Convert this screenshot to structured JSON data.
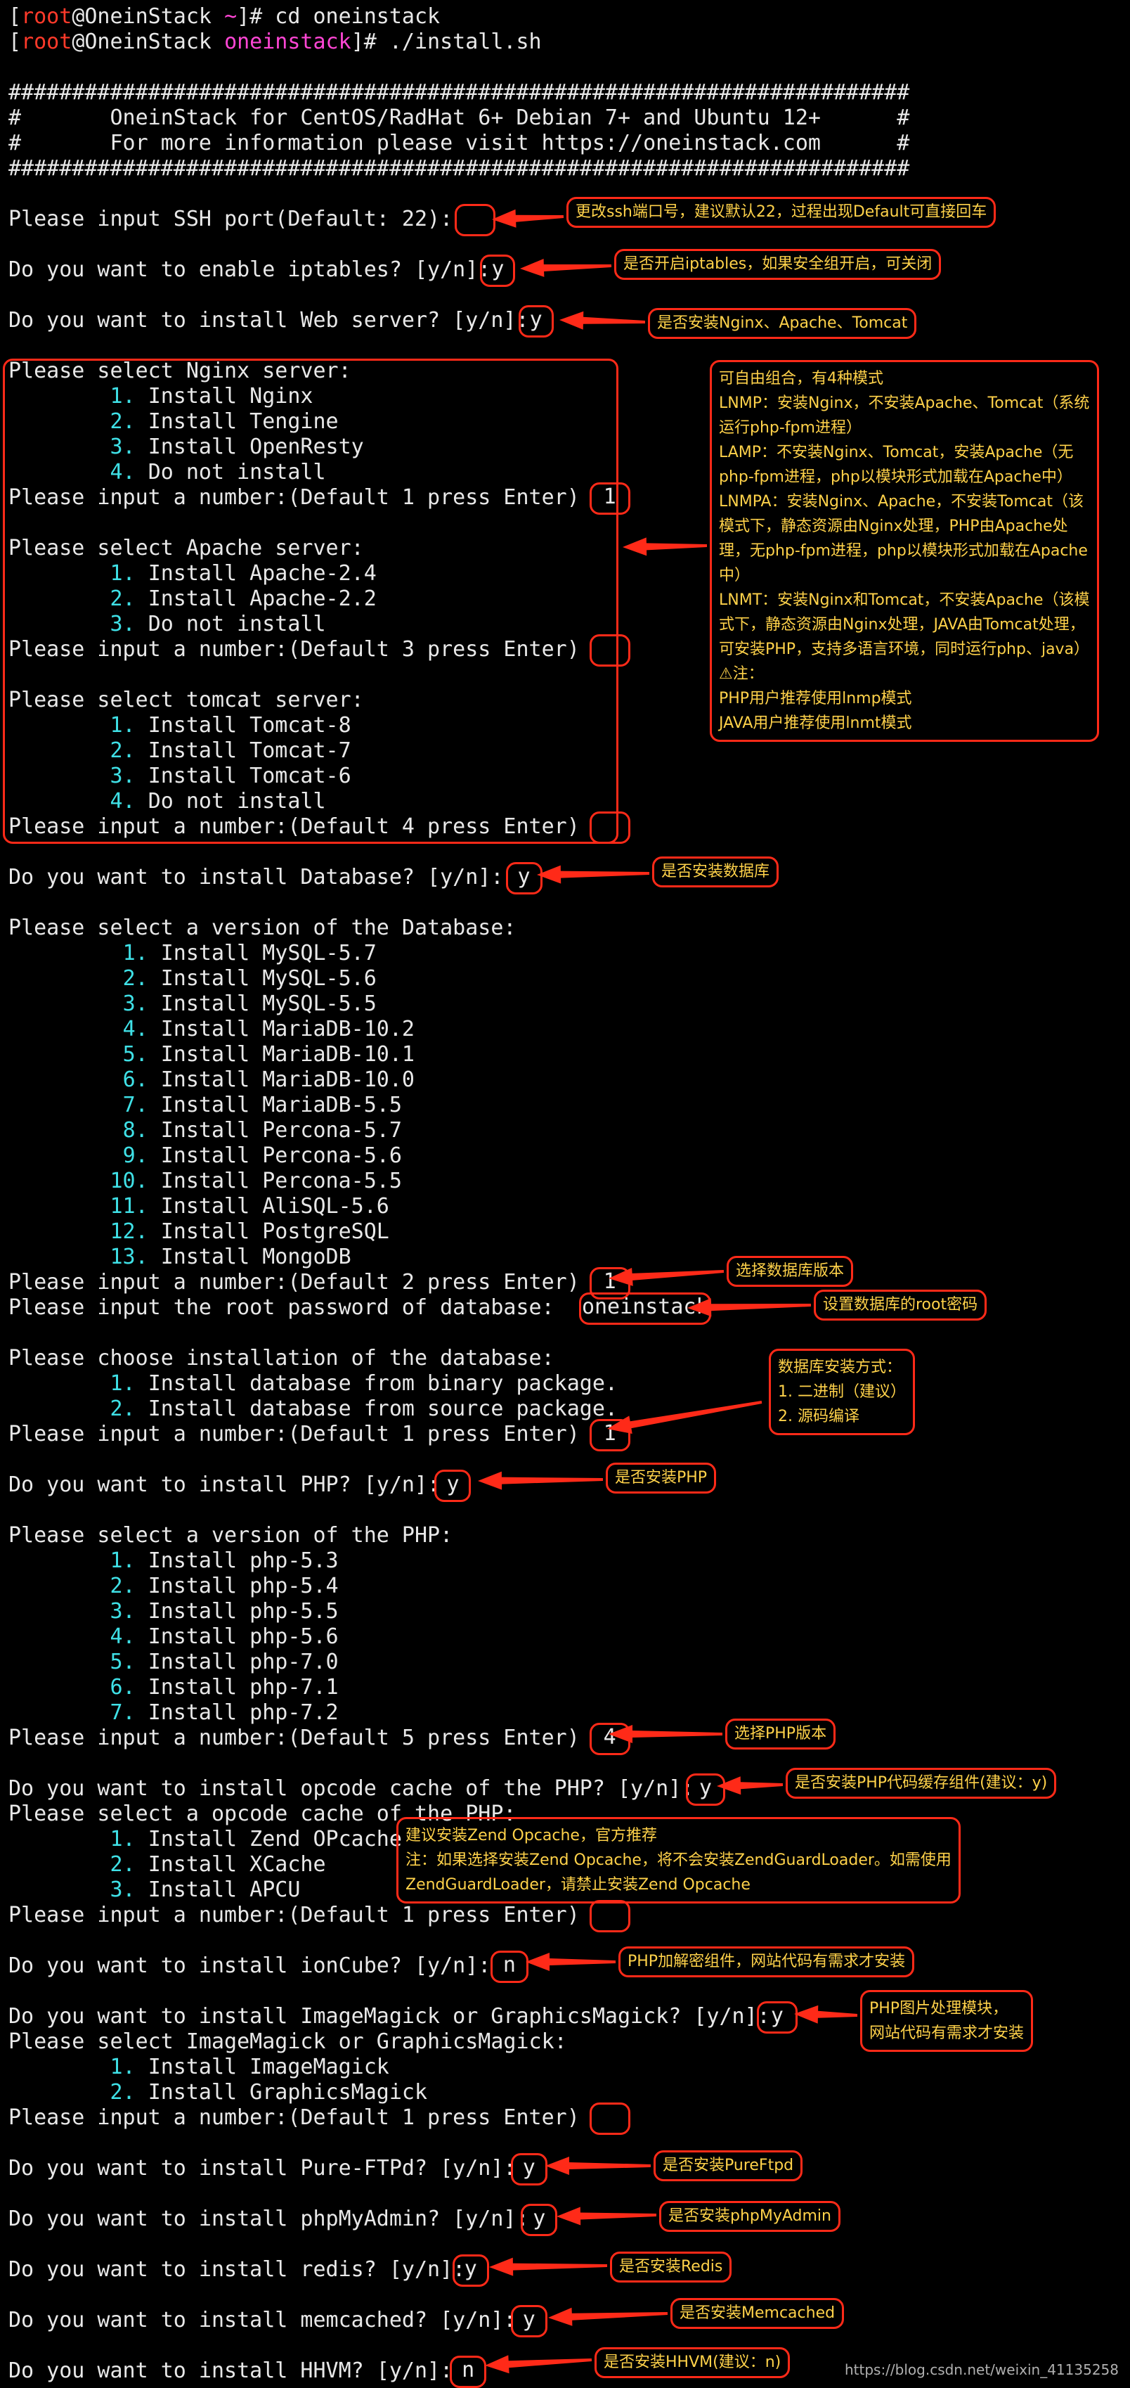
{
  "header": {
    "prompt1_root": "root",
    "prompt1_host": "@OneinStack ",
    "prompt1_dir": "~",
    "prompt1_cmd": "]# cd oneinstack",
    "prompt2_root": "root",
    "prompt2_host": "@OneinStack ",
    "prompt2_dir": "oneinstack",
    "prompt2_cmd": "]# ./install.sh"
  },
  "banner": [
    "#######################################################################",
    "#       OneinStack for CentOS/RadHat 6+ Debian 7+ and Ubuntu 12+      #",
    "#       For more information please visit https://oneinstack.com      #",
    "#######################################################################"
  ],
  "prompts": {
    "ssh": "Please input SSH port(Default: 22):",
    "iptables": "Do you want to enable iptables? [y/n]:",
    "web": "Do you want to install Web server? [y/n]:",
    "nginx_title": "Please select Nginx server:",
    "nginx_opts": [
      "Install Nginx",
      "Install Tengine",
      "Install OpenResty",
      "Do not install"
    ],
    "nginx_input": "Please input a number:(Default 1 press Enter)",
    "apache_title": "Please select Apache server:",
    "apache_opts": [
      "Install Apache-2.4",
      "Install Apache-2.2",
      "Do not install"
    ],
    "apache_input": "Please input a number:(Default 3 press Enter)",
    "tomcat_title": "Please select tomcat server:",
    "tomcat_opts": [
      "Install Tomcat-8",
      "Install Tomcat-7",
      "Install Tomcat-6",
      "Do not install"
    ],
    "tomcat_input": "Please input a number:(Default 4 press Enter)",
    "db": "Do you want to install Database? [y/n]:",
    "db_title": "Please select a version of the Database:",
    "db_opts": [
      "Install MySQL-5.7",
      "Install MySQL-5.6",
      "Install MySQL-5.5",
      "Install MariaDB-10.2",
      "Install MariaDB-10.1",
      "Install MariaDB-10.0",
      "Install MariaDB-5.5",
      "Install Percona-5.7",
      "Install Percona-5.6",
      "Install Percona-5.5",
      "Install AliSQL-5.6",
      "Install PostgreSQL",
      "Install MongoDB"
    ],
    "db_input": "Please input a number:(Default 2 press Enter)",
    "db_pwd": "Please input the root password of database:",
    "db_method_title": "Please choose installation of the database:",
    "db_method_opts": [
      "Install database from binary package.",
      "Install database from source package."
    ],
    "db_method_input": "Please input a number:(Default 1 press Enter)",
    "php": "Do you want to install PHP? [y/n]:",
    "php_title": "Please select a version of the PHP:",
    "php_opts": [
      "Install php-5.3",
      "Install php-5.4",
      "Install php-5.5",
      "Install php-5.6",
      "Install php-7.0",
      "Install php-7.1",
      "Install php-7.2"
    ],
    "php_input": "Please input a number:(Default 5 press Enter)",
    "opcode": "Do you want to install opcode cache of the PHP? [y/n]:",
    "opcode_title": "Please select a opcode cache of the PHP:",
    "opcode_opts": [
      "Install Zend OPcache",
      "Install XCache",
      "Install APCU"
    ],
    "opcode_input": "Please input a number:(Default 1 press Enter)",
    "ioncube": "Do you want to install ionCube? [y/n]:",
    "imagick": "Do you want to install ImageMagick or GraphicsMagick? [y/n]:",
    "imagick_title": "Please select ImageMagick or GraphicsMagick:",
    "imagick_opts": [
      "Install ImageMagick",
      "Install GraphicsMagick"
    ],
    "imagick_input": "Please input a number:(Default 1 press Enter)",
    "ftp": "Do you want to install Pure-FTPd? [y/n]:",
    "pma": "Do you want to install phpMyAdmin? [y/n]:",
    "redis": "Do you want to install redis? [y/n]:",
    "memcached": "Do you want to install memcached? [y/n]:",
    "hhvm": "Do you want to install HHVM? [y/n]:"
  },
  "inputs": {
    "iptables": "y",
    "web": "y",
    "nginx": "1",
    "db": "y",
    "db_version": "1",
    "db_pwd": "oneinstack",
    "db_method": "1",
    "php": "y",
    "php_version": "4",
    "opcode": "y",
    "ioncube": "n",
    "imagick": "y",
    "ftp": "y",
    "pma": "y",
    "redis": "y",
    "memcached": "y",
    "hhvm": "n"
  },
  "notes": {
    "ssh": "更改ssh端口号，建议默认22，过程出现Default可直接回车",
    "iptables": "是否开启iptables，如果安全组开启，可关闭",
    "web": "是否安装Nginx、Apache、Tomcat",
    "modes": [
      "可自由组合，有4种模式",
      "LNMP：安装Nginx，不安装Apache、Tomcat（系统",
      "运行php-fpm进程）",
      "LAMP：不安装Nginx、Tomcat，安装Apache（无",
      "php-fpm进程，php以模块形式加载在Apache中）",
      "LNMPA：安装Nginx、Apache，不安装Tomcat（该",
      "模式下，静态资源由Nginx处理，PHP由Apache处",
      "理，无php-fpm进程，php以模块形式加载在Apache",
      "中）",
      "LNMT：安装Nginx和Tomcat，不安装Apache（该模",
      "式下，静态资源由Nginx处理，JAVA由Tomcat处理，",
      "可安装PHP，支持多语言环境，同时运行php、java）",
      "⚠注：",
      "  PHP用户推荐使用lnmp模式",
      "  JAVA用户推荐使用lnmt模式"
    ],
    "db": "是否安装数据库",
    "db_version": "选择数据库版本",
    "db_pwd": "设置数据库的root密码",
    "db_method": [
      "数据库安装方式：",
      "1. 二进制（建议）",
      "2. 源码编译"
    ],
    "php": "是否安装PHP",
    "php_version": "选择PHP版本",
    "opcode": "是否安装PHP代码缓存组件(建议：y)",
    "opcode_detail": [
      "建议安装Zend Opcache，官方推荐",
      "注：如果选择安装Zend Opcache，将不会安装ZendGuardLoader。如需使用",
      "ZendGuardLoader，请禁止安装Zend Opcache"
    ],
    "ioncube": "PHP加解密组件，网站代码有需求才安装",
    "imagick": [
      "PHP图片处理模块，",
      "网站代码有需求才安装"
    ],
    "ftp": "是否安装PureFtpd",
    "pma": "是否安装phpMyAdmin",
    "redis": "是否安装Redis",
    "memcached": "是否安装Memcached",
    "hhvm": "是否安装HHVM(建议：n)"
  },
  "watermark": "https://blog.csdn.net/weixin_41135258"
}
